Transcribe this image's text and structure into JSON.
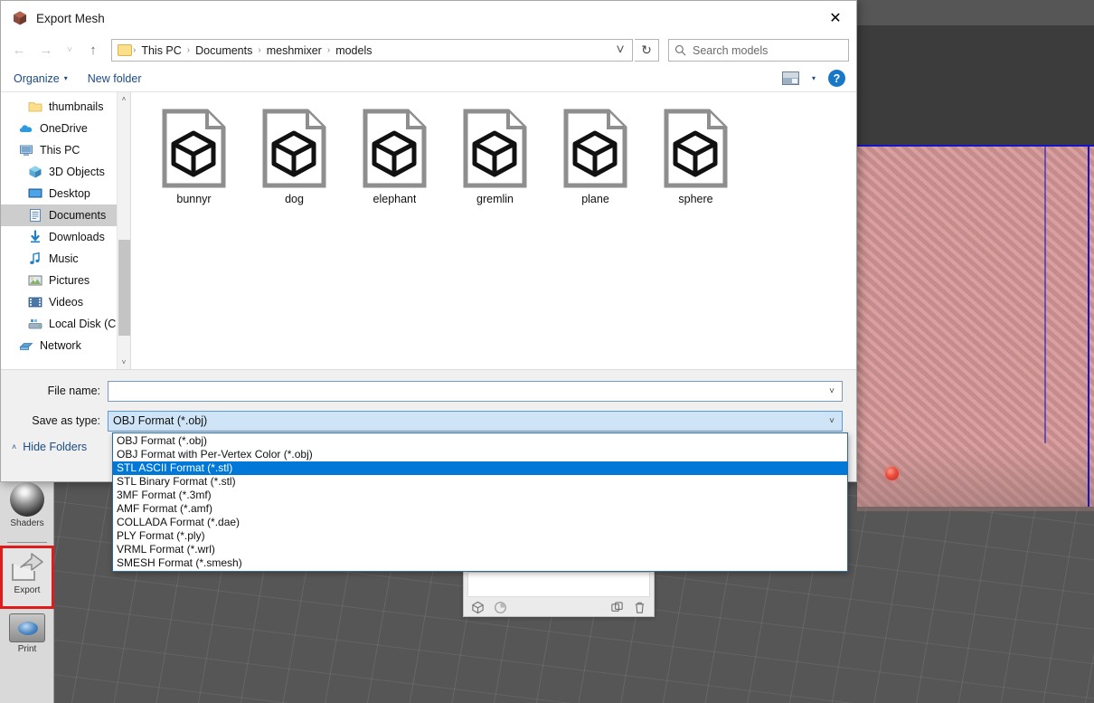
{
  "dialog": {
    "title": "Export Mesh",
    "title_icon": "mesh-cube-icon",
    "close_label": "✕"
  },
  "nav": {
    "back": "←",
    "forward": "→",
    "recent": "˅",
    "up": "↑",
    "refresh": "↻",
    "address_dropdown": "˅",
    "breadcrumbs": [
      "This PC",
      "Documents",
      "meshmixer",
      "models"
    ],
    "separator": "›"
  },
  "search": {
    "placeholder": "Search models",
    "icon": "search-icon"
  },
  "commandbar": {
    "organize": "Organize",
    "organize_caret": "▾",
    "new_folder": "New folder",
    "view_icon": "view-layout-icon",
    "view_caret": "▾",
    "help_icon": "help-icon",
    "help_glyph": "?"
  },
  "sidebar": {
    "items": [
      {
        "label": "thumbnails",
        "icon": "folder-icon",
        "indent": 1,
        "selected": false
      },
      {
        "label": "OneDrive",
        "icon": "cloud-icon",
        "indent": 0,
        "selected": false
      },
      {
        "label": "This PC",
        "icon": "computer-icon",
        "indent": 0,
        "selected": false
      },
      {
        "label": "3D Objects",
        "icon": "3d-objects-icon",
        "indent": 1,
        "selected": false
      },
      {
        "label": "Desktop",
        "icon": "desktop-icon",
        "indent": 1,
        "selected": false
      },
      {
        "label": "Documents",
        "icon": "documents-icon",
        "indent": 1,
        "selected": true
      },
      {
        "label": "Downloads",
        "icon": "downloads-icon",
        "indent": 1,
        "selected": false
      },
      {
        "label": "Music",
        "icon": "music-icon",
        "indent": 1,
        "selected": false
      },
      {
        "label": "Pictures",
        "icon": "pictures-icon",
        "indent": 1,
        "selected": false
      },
      {
        "label": "Videos",
        "icon": "videos-icon",
        "indent": 1,
        "selected": false
      },
      {
        "label": "Local Disk (C:)",
        "icon": "disk-icon",
        "indent": 1,
        "selected": false
      },
      {
        "label": "Network",
        "icon": "network-icon",
        "indent": 0,
        "selected": false
      }
    ],
    "scroll_up": "˄",
    "scroll_down": "˅"
  },
  "files": [
    {
      "name": "bunnyr",
      "icon": "3d-model-file-icon"
    },
    {
      "name": "dog",
      "icon": "3d-model-file-icon"
    },
    {
      "name": "elephant",
      "icon": "3d-model-file-icon"
    },
    {
      "name": "gremlin",
      "icon": "3d-model-file-icon"
    },
    {
      "name": "plane",
      "icon": "3d-model-file-icon"
    },
    {
      "name": "sphere",
      "icon": "3d-model-file-icon"
    }
  ],
  "form": {
    "filename_label": "File name:",
    "filename_value": "",
    "savetype_label": "Save as type:",
    "savetype_value": "OBJ Format (*.obj)",
    "combo_arrow": "˅",
    "hide_folders": "Hide Folders",
    "hide_folders_caret": "˄"
  },
  "format_dropdown": {
    "selected_index": 2,
    "options": [
      "OBJ Format (*.obj)",
      "OBJ Format with Per-Vertex Color (*.obj)",
      "STL ASCII Format (*.stl)",
      "STL Binary Format (*.stl)",
      "3MF Format (*.3mf)",
      "AMF Format (*.amf)",
      "COLLADA Format (*.dae)",
      "PLY Format (*.ply)",
      "VRML Format (*.wrl)",
      "SMESH Format (*.smesh)"
    ]
  },
  "tool_rail": {
    "items": [
      {
        "label": "Shaders",
        "icon": "shader-sphere-icon",
        "selected": false
      },
      {
        "label": "Export",
        "icon": "export-arrow-icon",
        "selected": true
      },
      {
        "label": "Print",
        "icon": "printer-icon",
        "selected": false
      }
    ]
  },
  "mini_panel": {
    "icons": [
      {
        "name": "cube-icon"
      },
      {
        "name": "pie-chart-icon"
      },
      {
        "name": "duplicate-icon"
      },
      {
        "name": "trash-icon"
      }
    ]
  },
  "colors": {
    "accent": "#0078d7",
    "selection_highlight": "#cfe4f7",
    "export_highlight": "#e01b1b",
    "plate": "#c49090",
    "plate_border": "#1515c8",
    "viewport_bg": "#565656",
    "link": "#1b4b84"
  }
}
